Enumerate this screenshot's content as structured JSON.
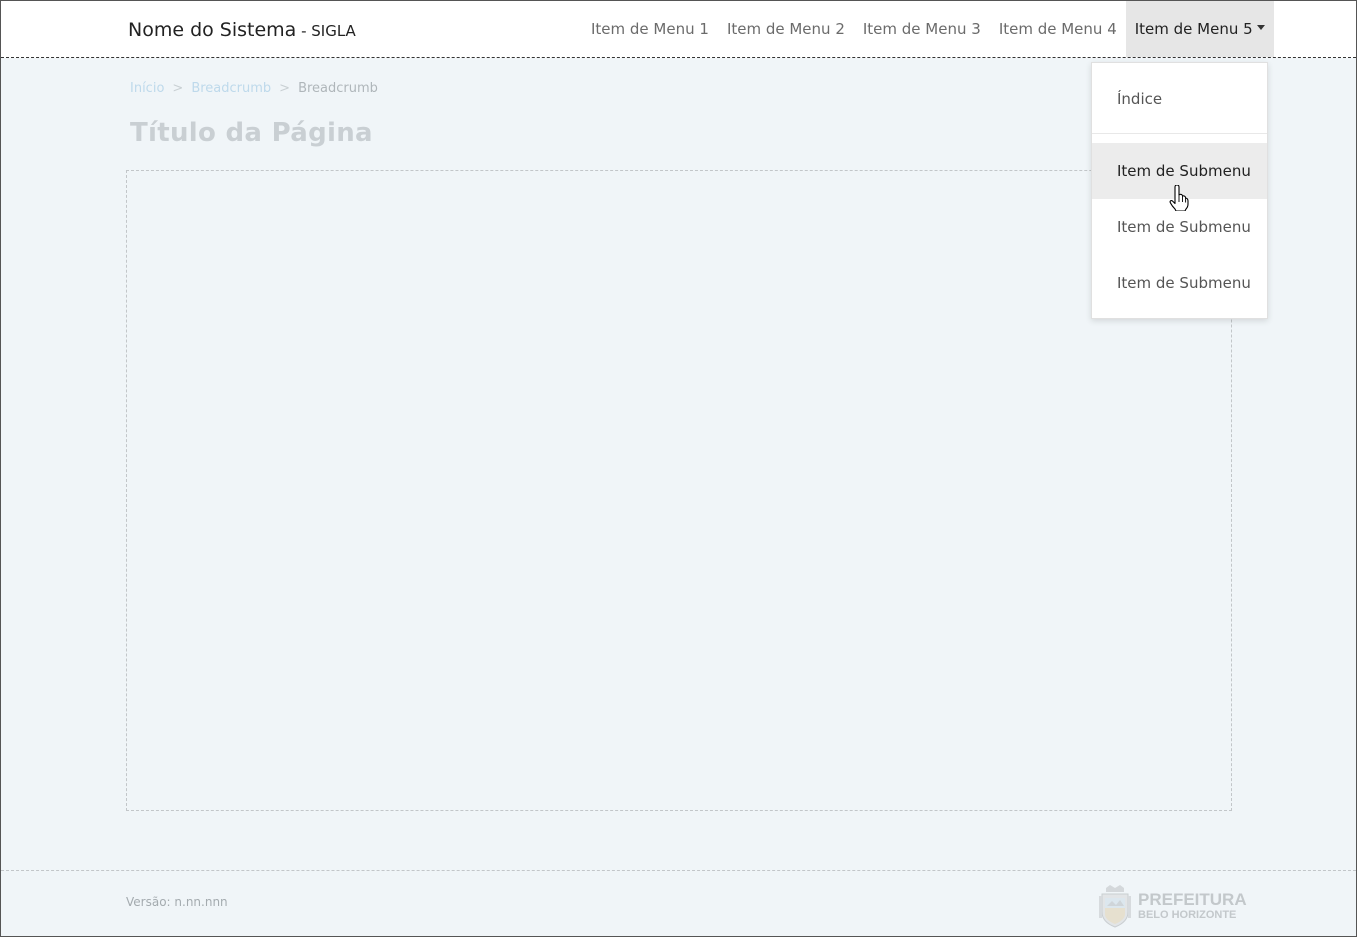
{
  "header": {
    "system_name": "Nome do Sistema",
    "sigla": " - SIGLA",
    "menu": [
      {
        "label": "Item de Menu 1"
      },
      {
        "label": "Item de Menu 2"
      },
      {
        "label": "Item de Menu 3"
      },
      {
        "label": "Item de Menu 4"
      },
      {
        "label": "Item de Menu 5",
        "active": true
      }
    ]
  },
  "dropdown": {
    "items": [
      {
        "label": "Índice"
      },
      {
        "label": "Item de Submenu",
        "hovered": true
      },
      {
        "label": "Item de Submenu"
      },
      {
        "label": "Item de Submenu"
      }
    ]
  },
  "breadcrumb": {
    "home": "Início",
    "separator": ">",
    "link": "Breadcrumb",
    "current": "Breadcrumb"
  },
  "page": {
    "title": "Título da Página"
  },
  "footer": {
    "version": "Versão: n.nn.nnn",
    "logo_line1": "PREFEITURA",
    "logo_line2": "BELO HORIZONTE"
  },
  "colors": {
    "background": "#f0f5f8",
    "navbar": "#ffffff",
    "active_menu": "#e6e6e6",
    "breadcrumb_link": "#b9d7ea"
  }
}
